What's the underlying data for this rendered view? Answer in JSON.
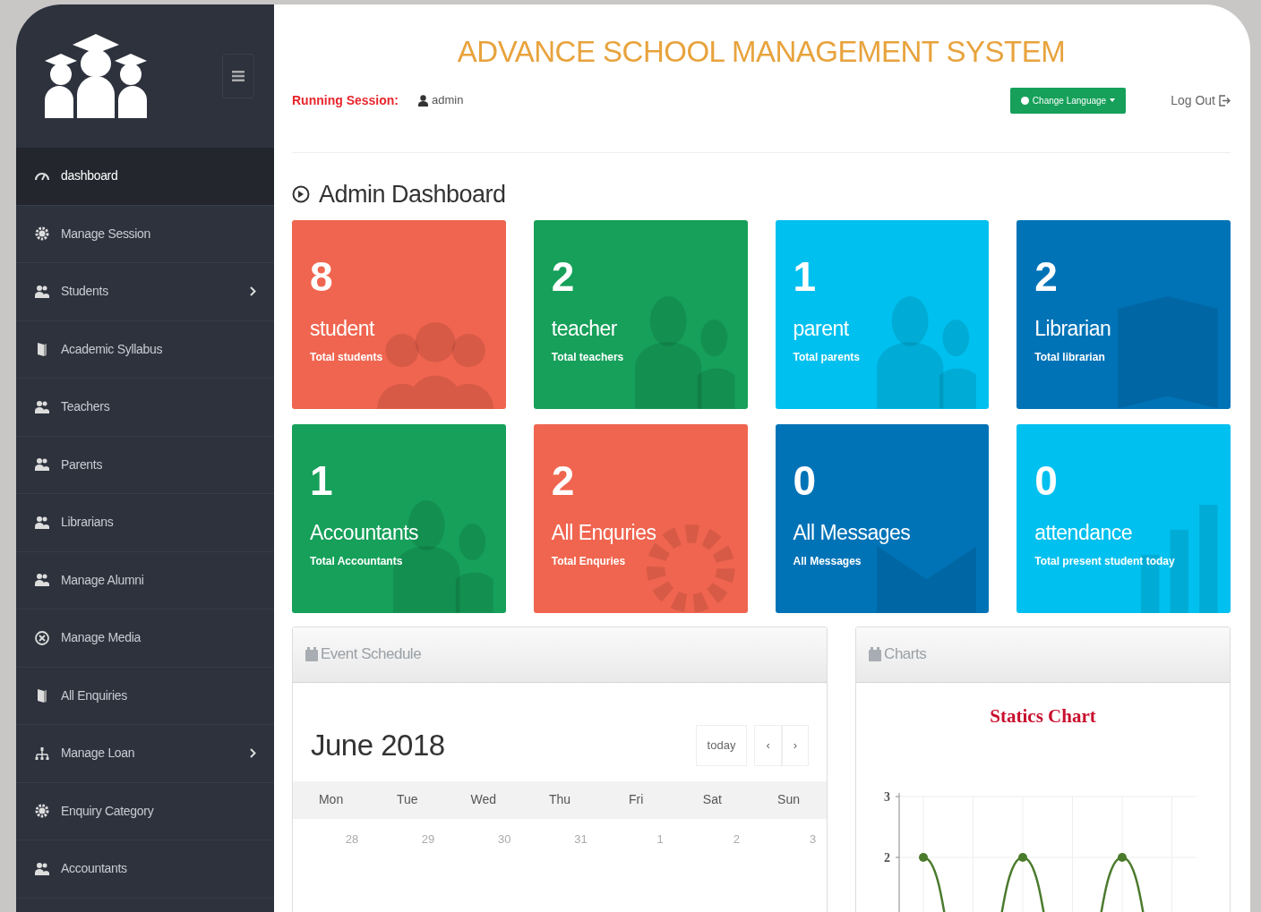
{
  "header": {
    "title": "ADVANCE SCHOOL MANAGEMENT SYSTEM",
    "session_label": "Running Session:",
    "user": "admin",
    "language_button": "Change Language",
    "logout": "Log Out"
  },
  "sidebar": {
    "items": [
      {
        "label": "dashboard",
        "selected": true,
        "submenu": false
      },
      {
        "label": "Manage Session",
        "selected": false,
        "submenu": false
      },
      {
        "label": "Students",
        "selected": false,
        "submenu": true
      },
      {
        "label": "Academic Syllabus",
        "selected": false,
        "submenu": false
      },
      {
        "label": "Teachers",
        "selected": false,
        "submenu": false
      },
      {
        "label": "Parents",
        "selected": false,
        "submenu": false
      },
      {
        "label": "Librarians",
        "selected": false,
        "submenu": false
      },
      {
        "label": "Manage Alumni",
        "selected": false,
        "submenu": false
      },
      {
        "label": "Manage Media",
        "selected": false,
        "submenu": false
      },
      {
        "label": "All Enquiries",
        "selected": false,
        "submenu": false
      },
      {
        "label": "Manage Loan",
        "selected": false,
        "submenu": true
      },
      {
        "label": "Enquiry Category",
        "selected": false,
        "submenu": false
      },
      {
        "label": "Accountants",
        "selected": false,
        "submenu": false
      }
    ]
  },
  "page_title": "Admin Dashboard",
  "tiles": [
    {
      "count": "8",
      "title": "student",
      "subtitle": "Total students",
      "color": "#f0654f"
    },
    {
      "count": "2",
      "title": "teacher",
      "subtitle": "Total teachers",
      "color": "#16a05a"
    },
    {
      "count": "1",
      "title": "parent",
      "subtitle": "Total parents",
      "color": "#00c0ef"
    },
    {
      "count": "2",
      "title": "Librarian",
      "subtitle": "Total librarian",
      "color": "#0073b7"
    },
    {
      "count": "1",
      "title": "Accountants",
      "subtitle": "Total Accountants",
      "color": "#16a05a"
    },
    {
      "count": "2",
      "title": "All Enquries",
      "subtitle": "Total Enquries",
      "color": "#f0654f"
    },
    {
      "count": "0",
      "title": "All Messages",
      "subtitle": "All Messages",
      "color": "#0073b7"
    },
    {
      "count": "0",
      "title": "attendance",
      "subtitle": "Total present student today",
      "color": "#00c0ef"
    }
  ],
  "event_panel": {
    "title": "Event Schedule",
    "month": "June 2018",
    "today_button": "today",
    "prev_button": "‹",
    "next_button": "›",
    "weekdays": [
      "Mon",
      "Tue",
      "Wed",
      "Thu",
      "Fri",
      "Sat",
      "Sun"
    ],
    "dates": [
      "28",
      "29",
      "30",
      "31",
      "1",
      "2",
      "3"
    ]
  },
  "charts_panel": {
    "title": "Charts",
    "chart_title": "Statics Chart",
    "chart_data": {
      "type": "line",
      "ylim": [
        0,
        3
      ],
      "yticks": [
        2,
        3
      ],
      "grid": true,
      "series": [
        {
          "color": "#4a7a2c",
          "marker": "circle",
          "values": [
            2,
            null,
            2,
            null,
            2,
            null
          ]
        }
      ]
    }
  }
}
